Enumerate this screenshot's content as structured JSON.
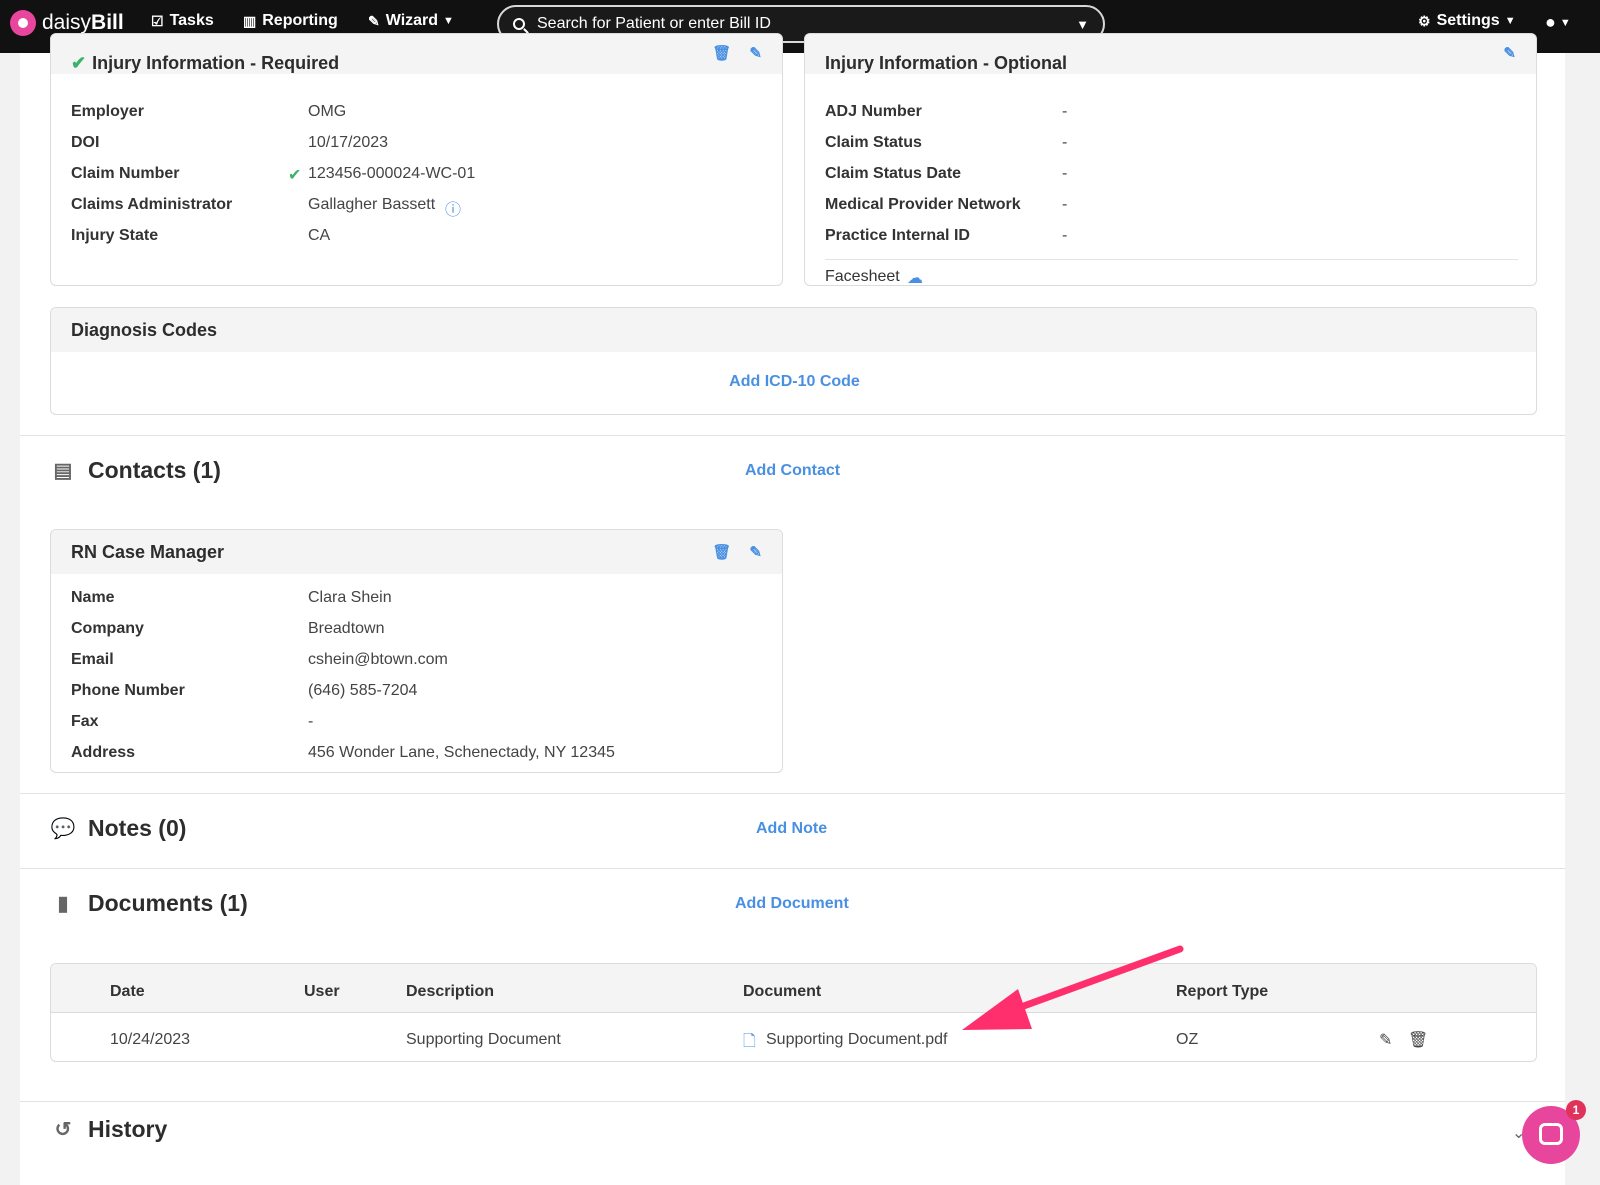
{
  "topbar": {
    "brand_light": "daisy",
    "brand_bold": "Bill",
    "nav": {
      "tasks": "Tasks",
      "reporting": "Reporting",
      "wizard": "Wizard",
      "settings": "Settings"
    },
    "search_placeholder": "Search for Patient or enter Bill ID"
  },
  "injury_required": {
    "title": "Injury Information - Required",
    "rows": [
      {
        "label": "Employer",
        "value": "OMG"
      },
      {
        "label": "DOI",
        "value": "10/17/2023"
      },
      {
        "label": "Claim Number",
        "value": "123456-000024-WC-01"
      },
      {
        "label": "Claims Administrator",
        "value": "Gallagher Bassett"
      },
      {
        "label": "Injury State",
        "value": "CA"
      }
    ]
  },
  "injury_optional": {
    "title": "Injury Information - Optional",
    "rows": [
      {
        "label": "ADJ Number",
        "value": "-"
      },
      {
        "label": "Claim Status",
        "value": "-"
      },
      {
        "label": "Claim Status Date",
        "value": "-"
      },
      {
        "label": "Medical Provider Network",
        "value": "-"
      },
      {
        "label": "Practice Internal ID",
        "value": "-"
      }
    ],
    "facesheet_link": "Facesheet"
  },
  "diagnosis": {
    "title": "Diagnosis Codes",
    "add_link": "Add ICD-10 Code"
  },
  "contacts": {
    "title": "Contacts (1)",
    "add_link": "Add Contact",
    "card": {
      "title": "RN Case Manager",
      "rows": [
        {
          "label": "Name",
          "value": "Clara Shein"
        },
        {
          "label": "Company",
          "value": "Breadtown"
        },
        {
          "label": "Email",
          "value": "cshein@btown.com"
        },
        {
          "label": "Phone Number",
          "value": "(646) 585-7204"
        },
        {
          "label": "Fax",
          "value": "-"
        },
        {
          "label": "Address",
          "value": "456 Wonder Lane, Schenectady, NY 12345"
        }
      ]
    }
  },
  "notes": {
    "title": "Notes (0)",
    "add_link": "Add Note"
  },
  "documents": {
    "title": "Documents (1)",
    "add_link": "Add Document",
    "columns": [
      "Date",
      "User",
      "Description",
      "Document",
      "Report Type"
    ],
    "rows": [
      {
        "date": "10/24/2023",
        "user": "",
        "description": "Supporting Document",
        "document": "Supporting Document.pdf",
        "report_type": "OZ"
      }
    ]
  },
  "history": {
    "title": "History"
  },
  "chat": {
    "badge": "1"
  },
  "colors": {
    "accent": "#4a90e2",
    "brand_pink": "#e8459c",
    "annotation_arrow": "#ff2f6d",
    "topbar": "#111111"
  }
}
